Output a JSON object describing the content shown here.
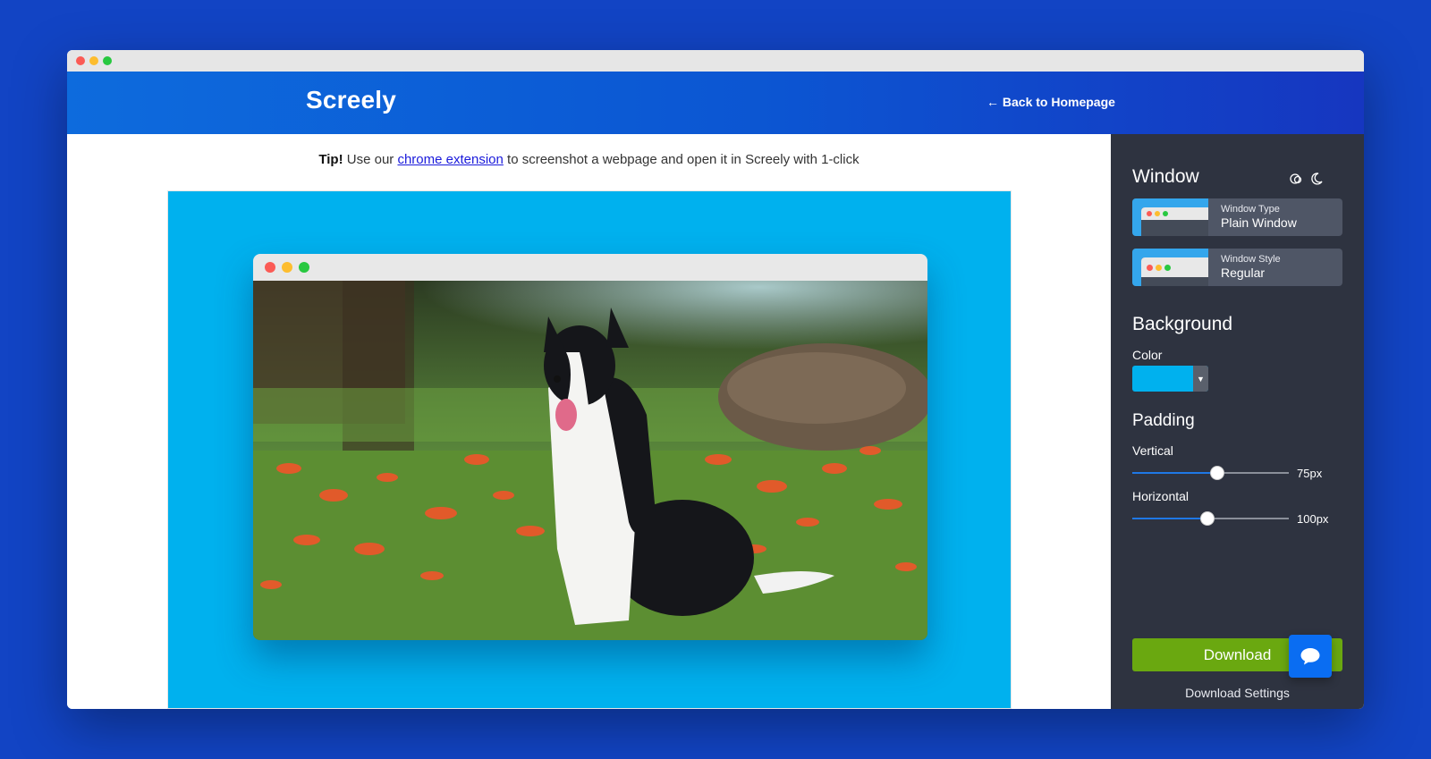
{
  "header": {
    "brand": "Screely",
    "back_link": "← Back to Homepage"
  },
  "tip": {
    "strong": "Tip!",
    "before_link": "Use our",
    "link": "chrome extension",
    "after_link": "to screenshot a webpage and open it in Screely with 1-click"
  },
  "preview": {
    "background_color": "#00b1ee",
    "image_alt": "dog-photo"
  },
  "sidebar": {
    "window_title": "Window",
    "window_type": {
      "label": "Window Type",
      "value": "Plain Window"
    },
    "window_style": {
      "label": "Window Style",
      "value": "Regular"
    },
    "background_title": "Background",
    "color_label": "Color",
    "color_value": "#00b1ee",
    "padding_title": "Padding",
    "vertical": {
      "label": "Vertical",
      "value_text": "75px",
      "value": 75,
      "max": 100
    },
    "horizontal": {
      "label": "Horizontal",
      "value_text": "100px",
      "value": 100,
      "max": 150
    },
    "download_label": "Download",
    "download_settings_label": "Download Settings"
  },
  "colors": {
    "accent": "#0c55d2",
    "download": "#6aa810",
    "sidebar": "#2e3340"
  }
}
